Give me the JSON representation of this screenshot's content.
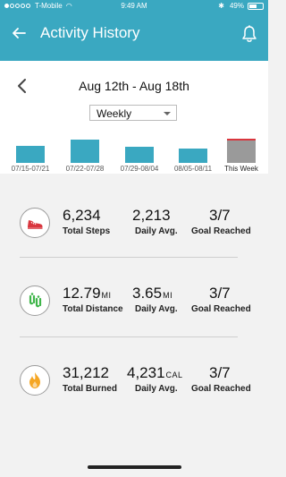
{
  "status": {
    "carrier": "T-Mobile",
    "time": "9:49 AM",
    "battery": "49%",
    "battery_level": 0.49
  },
  "app_bar": {
    "title": "Activity History",
    "back_icon": "arrow-left-icon",
    "bell_icon": "bell-icon"
  },
  "header": {
    "date_range": "Aug 12th - Aug 18th",
    "period_select": "Weekly"
  },
  "weeks": [
    {
      "label": "07/15-07/21",
      "fraction": 0.64
    },
    {
      "label": "07/22-07/28",
      "fraction": 0.85
    },
    {
      "label": "07/29-08/04",
      "fraction": 0.59
    },
    {
      "label": "08/05-08/11",
      "fraction": 0.52
    },
    {
      "label": "This Week",
      "fraction": 0.89,
      "current": true
    }
  ],
  "stats": [
    {
      "icon": "shoe-icon",
      "total": "6,234",
      "total_unit": "",
      "total_label": "Total Steps",
      "avg": "2,213",
      "avg_unit": "",
      "avg_label": "Daily Avg.",
      "goal": "3/7",
      "goal_label": "Goal Reached"
    },
    {
      "icon": "footsteps-icon",
      "total": "12.79",
      "total_unit": "MI",
      "total_label": "Total Distance",
      "avg": "3.65",
      "avg_unit": "MI",
      "avg_label": "Daily Avg.",
      "goal": "3/7",
      "goal_label": "Goal Reached"
    },
    {
      "icon": "flame-icon",
      "total": "31,212",
      "total_unit": "",
      "total_label": "Total Burned",
      "avg": "4,231",
      "avg_unit": "CAL",
      "avg_label": "Daily Avg.",
      "goal": "3/7",
      "goal_label": "Goal Reached"
    }
  ],
  "colors": {
    "accent": "#3aa8c1",
    "goal_line": "#d9363e",
    "current_bar": "#9a9a9a",
    "shoe": "#d9363e",
    "footsteps": "#3fb54a",
    "flame": "#f5a623"
  }
}
